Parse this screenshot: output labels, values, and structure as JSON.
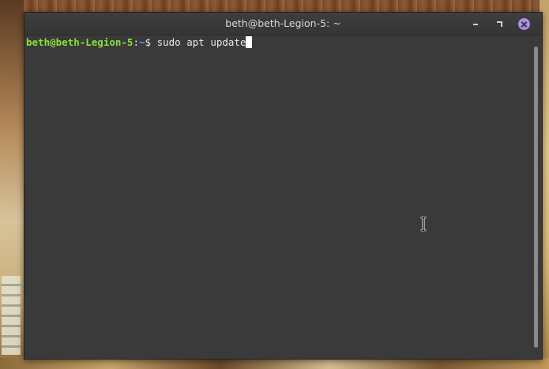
{
  "window": {
    "title": "beth@beth-Legion-5: ~",
    "controls": {
      "minimize_icon": "minimize-icon",
      "maximize_icon": "maximize-icon",
      "close_icon": "close-icon",
      "close_color": "#a98ee6"
    }
  },
  "terminal": {
    "prompt_user": "beth@beth-Legion-5",
    "prompt_colon": ":",
    "prompt_path": "~",
    "prompt_symbol": "$ ",
    "command": "sudo apt update",
    "colors": {
      "background": "#3a3a3a",
      "user_color": "#8ae234",
      "path_color": "#729fcf",
      "text_color": "#e8e8e8"
    }
  },
  "pointer": {
    "icon": "ibeam-cursor-icon"
  }
}
